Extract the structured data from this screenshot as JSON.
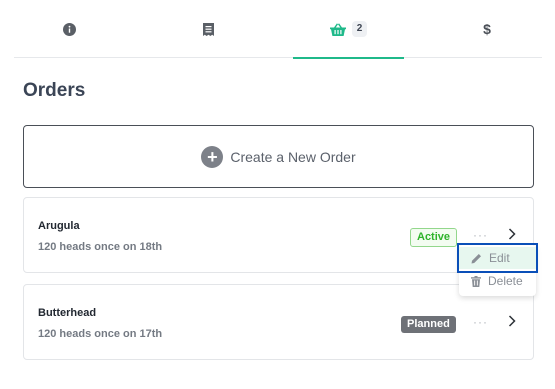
{
  "tabs": [
    {
      "name": "info",
      "icon": "info-circle-icon"
    },
    {
      "name": "receipt",
      "icon": "receipt-icon"
    },
    {
      "name": "orders",
      "icon": "basket-icon",
      "badge": "2",
      "active": true
    },
    {
      "name": "pricing",
      "icon": "dollar-icon"
    }
  ],
  "page": {
    "title": "Orders"
  },
  "create": {
    "label": "Create a New Order",
    "icon": "plus-circle-icon"
  },
  "orders": [
    {
      "name": "Arugula",
      "description": "120 heads once on 18th",
      "status": "Active",
      "status_color": "#2fb32b"
    },
    {
      "name": "Butterhead",
      "description": "120 heads once on 17th",
      "status": "Planned",
      "status_color": "#6e7177"
    }
  ],
  "dropdown": {
    "edit_label": "Edit",
    "delete_label": "Delete"
  },
  "colors": {
    "accent": "#1fb98a",
    "focus": "#0a4fb8"
  }
}
